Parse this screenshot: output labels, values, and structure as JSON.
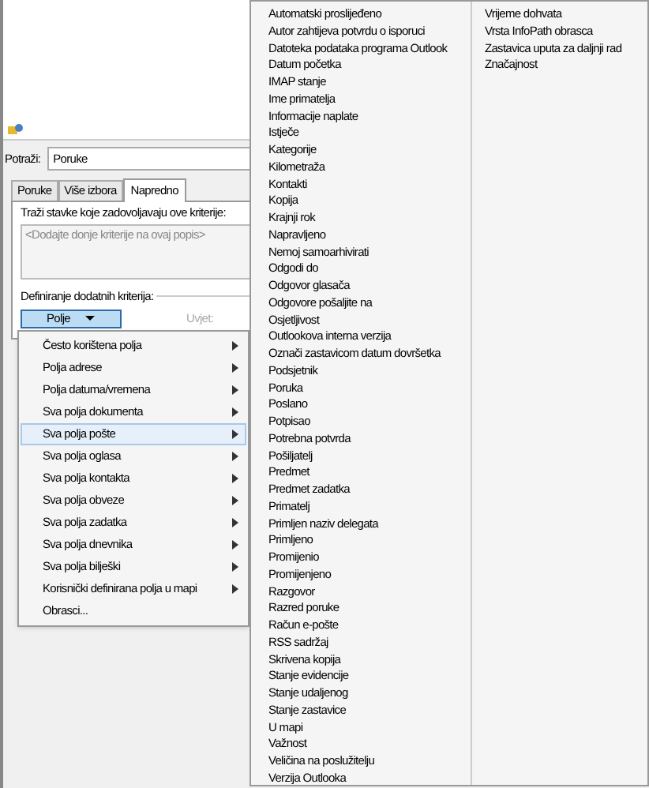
{
  "search": {
    "label": "Potraži:",
    "value": "Poruke"
  },
  "tabs": [
    {
      "label": "Poruke",
      "selected": false
    },
    {
      "label": "Više izbora",
      "selected": false
    },
    {
      "label": "Napredno",
      "selected": true
    }
  ],
  "criteria": {
    "label": "Traži stavke koje zadovoljavaju ove kriterije:",
    "placeholder": "<Dodajte donje kriterije na ovaj popis>"
  },
  "define": {
    "label": "Definiranje dodatnih kriterija:",
    "field_button": "Polje",
    "condition_label": "Uvjet:"
  },
  "menu": {
    "items": [
      {
        "label": "Često korištena polja",
        "has_submenu": true,
        "selected": false
      },
      {
        "label": "Polja adrese",
        "has_submenu": true,
        "selected": false
      },
      {
        "label": "Polja datuma/vremena",
        "has_submenu": true,
        "selected": false
      },
      {
        "label": "Sva polja dokumenta",
        "has_submenu": true,
        "selected": false
      },
      {
        "label": "Sva polja pošte",
        "has_submenu": true,
        "selected": true
      },
      {
        "label": "Sva polja oglasa",
        "has_submenu": true,
        "selected": false
      },
      {
        "label": "Sva polja kontakta",
        "has_submenu": true,
        "selected": false
      },
      {
        "label": "Sva polja obveze",
        "has_submenu": true,
        "selected": false
      },
      {
        "label": "Sva polja zadatka",
        "has_submenu": true,
        "selected": false
      },
      {
        "label": "Sva polja dnevnika",
        "has_submenu": true,
        "selected": false
      },
      {
        "label": "Sva polja bilješki",
        "has_submenu": true,
        "selected": false
      },
      {
        "label": "Korisnički definirana polja u mapi",
        "has_submenu": true,
        "selected": false
      },
      {
        "label": "Obrasci...",
        "has_submenu": false,
        "selected": false
      }
    ]
  },
  "submenu": {
    "columns": [
      [
        "Automatski proslijeđeno",
        "Autor zahtijeva potvrdu o isporuci",
        "Datoteka podataka programa Outlook",
        "Datum početka",
        "IMAP stanje",
        "Ime primatelja",
        "Informacije naplate",
        "Istječe",
        "Kategorije",
        "Kilometraža",
        "Kontakti",
        "Kopija",
        "Krajnji rok",
        "Napravljeno",
        "Nemoj samoarhivirati",
        "Odgodi do",
        "Odgovor glasača",
        "Odgovore pošaljite na",
        "Osjetljivost",
        "Outlookova interna verzija",
        "Označi zastavicom datum dovršetka",
        "Podsjetnik",
        "Poruka",
        "Poslano",
        "Potpisao",
        "Potrebna potvrda",
        "Pošiljatelj",
        "Predmet",
        "Predmet zadatka",
        "Primatelj",
        "Primljen naziv delegata",
        "Primljeno",
        "Promijenio",
        "Promijenjeno",
        "Razgovor",
        "Razred poruke",
        "Račun e-pošte",
        "RSS sadržaj",
        "Skrivena kopija",
        "Stanje evidencije",
        "Stanje udaljenog",
        "Stanje zastavice",
        "U mapi",
        "Važnost",
        "Veličina na poslužitelju",
        "Verzija Outlooka"
      ],
      [
        "Vrijeme dohvata",
        "Vrsta InfoPath obrasca",
        "Zastavica uputa za daljnji rad",
        "Značajnost"
      ]
    ]
  }
}
